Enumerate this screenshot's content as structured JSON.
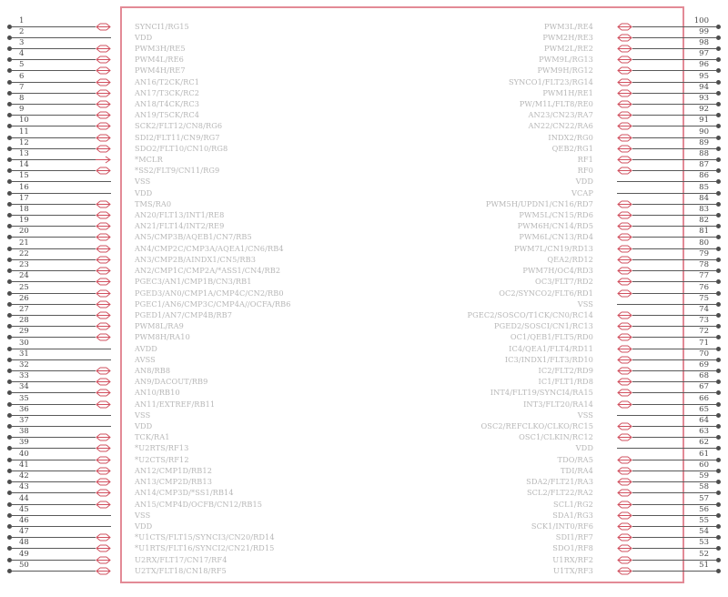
{
  "diagram": {
    "type": "ic-pinout",
    "package_pins": 100,
    "colors": {
      "body_outline": "#e38a96",
      "pin_label_text": "#b7b7b7",
      "pin_number_text": "#4a4a4a",
      "lead_line": "#595959",
      "arrow": "#d0505f",
      "background": "#ffffff"
    },
    "left_pins": [
      {
        "num": "1",
        "label": "SYNCI1/RG15",
        "io": "bidir"
      },
      {
        "num": "2",
        "label": "VDD",
        "io": "power"
      },
      {
        "num": "3",
        "label": "PWM3H/RE5",
        "io": "bidir"
      },
      {
        "num": "4",
        "label": "PWM4L/RE6",
        "io": "bidir"
      },
      {
        "num": "5",
        "label": "PWM4H/RE7",
        "io": "bidir"
      },
      {
        "num": "6",
        "label": "AN16/T2CK/RC1",
        "io": "bidir"
      },
      {
        "num": "7",
        "label": "AN17/T3CK/RC2",
        "io": "bidir"
      },
      {
        "num": "8",
        "label": "AN18/T4CK/RC3",
        "io": "bidir"
      },
      {
        "num": "9",
        "label": "AN19/T5CK/RC4",
        "io": "bidir"
      },
      {
        "num": "10",
        "label": "SCK2/FLT12/CN8/RG6",
        "io": "bidir"
      },
      {
        "num": "11",
        "label": "SDI2/FLT11/CN9/RG7",
        "io": "bidir"
      },
      {
        "num": "12",
        "label": "SDO2/FLT10/CN10/RG8",
        "io": "bidir"
      },
      {
        "num": "13",
        "label": "*MCLR",
        "io": "in"
      },
      {
        "num": "14",
        "label": "*SS2/FLT9/CN11/RG9",
        "io": "bidir"
      },
      {
        "num": "15",
        "label": "VSS",
        "io": "power"
      },
      {
        "num": "16",
        "label": "VDD",
        "io": "power"
      },
      {
        "num": "17",
        "label": "TMS/RA0",
        "io": "bidir"
      },
      {
        "num": "18",
        "label": "AN20/FLT13/INT1/RE8",
        "io": "bidir"
      },
      {
        "num": "19",
        "label": "AN21/FLT14/INT2/RE9",
        "io": "bidir"
      },
      {
        "num": "20",
        "label": "AN5/CMP3B/AQEB1/CN7/RB5",
        "io": "bidir"
      },
      {
        "num": "21",
        "label": "AN4/CMP2C/CMP3A/AQEA1/CN6/RB4",
        "io": "bidir"
      },
      {
        "num": "22",
        "label": "AN3/CMP2B/AINDX1/CN5/RB3",
        "io": "bidir"
      },
      {
        "num": "23",
        "label": "AN2/CMP1C/CMP2A/*ASS1/CN4/RB2",
        "io": "bidir"
      },
      {
        "num": "24",
        "label": "PGEC3/AN1/CMP1B/CN3/RB1",
        "io": "bidir"
      },
      {
        "num": "25",
        "label": "PGED3/AN0/CMP1A/CMP4C/CN2/RB0",
        "io": "bidir"
      },
      {
        "num": "26",
        "label": "PGEC1/AN6/CMP3C/CMP4A//OCFA/RB6",
        "io": "bidir"
      },
      {
        "num": "27",
        "label": "PGED1/AN7/CMP4B/RB7",
        "io": "bidir"
      },
      {
        "num": "28",
        "label": "PWM8L/RA9",
        "io": "bidir"
      },
      {
        "num": "29",
        "label": "PWM8H/RA10",
        "io": "bidir"
      },
      {
        "num": "30",
        "label": "AVDD",
        "io": "power"
      },
      {
        "num": "31",
        "label": "AVSS",
        "io": "power"
      },
      {
        "num": "32",
        "label": "AN8/RB8",
        "io": "bidir"
      },
      {
        "num": "33",
        "label": "AN9/DACOUT/RB9",
        "io": "bidir"
      },
      {
        "num": "34",
        "label": "AN10/RB10",
        "io": "bidir"
      },
      {
        "num": "35",
        "label": "AN11/EXTREF/RB11",
        "io": "bidir"
      },
      {
        "num": "36",
        "label": "VSS",
        "io": "power"
      },
      {
        "num": "37",
        "label": "VDD",
        "io": "power"
      },
      {
        "num": "38",
        "label": "TCK/RA1",
        "io": "bidir"
      },
      {
        "num": "39",
        "label": "*U2RTS/RF13",
        "io": "bidir"
      },
      {
        "num": "40",
        "label": "*U2CTS/RF12",
        "io": "bidir"
      },
      {
        "num": "41",
        "label": "AN12/CMP1D/RB12",
        "io": "bidir"
      },
      {
        "num": "42",
        "label": "AN13/CMP2D/RB13",
        "io": "bidir"
      },
      {
        "num": "43",
        "label": "AN14/CMP3D/*SS1/RB14",
        "io": "bidir"
      },
      {
        "num": "44",
        "label": "AN15/CMP4D/OCFB/CN12/RB15",
        "io": "bidir"
      },
      {
        "num": "45",
        "label": "VSS",
        "io": "power"
      },
      {
        "num": "46",
        "label": "VDD",
        "io": "power"
      },
      {
        "num": "47",
        "label": "*U1CTS/FLT15/SYNCI3/CN20/RD14",
        "io": "bidir"
      },
      {
        "num": "48",
        "label": "*U1RTS/FLT16/SYNCI2/CN21/RD15",
        "io": "bidir"
      },
      {
        "num": "49",
        "label": "U2RX/FLT17/CN17/RF4",
        "io": "bidir"
      },
      {
        "num": "50",
        "label": "U2TX/FLT18/CN18/RF5",
        "io": "bidir"
      }
    ],
    "right_pins": [
      {
        "num": "100",
        "label": "PWM3L/RE4",
        "io": "bidir"
      },
      {
        "num": "99",
        "label": "PWM2H/RE3",
        "io": "bidir"
      },
      {
        "num": "98",
        "label": "PWM2L/RE2",
        "io": "bidir"
      },
      {
        "num": "97",
        "label": "PWM9L/RG13",
        "io": "bidir"
      },
      {
        "num": "96",
        "label": "PWM9H/RG12",
        "io": "bidir"
      },
      {
        "num": "95",
        "label": "SYNCO1/FLT23/RG14",
        "io": "bidir"
      },
      {
        "num": "94",
        "label": "PWM1H/RE1",
        "io": "bidir"
      },
      {
        "num": "93",
        "label": "PW/M1L/FLT8/RE0",
        "io": "bidir"
      },
      {
        "num": "92",
        "label": "AN23/CN23/RA7",
        "io": "bidir"
      },
      {
        "num": "91",
        "label": "AN22/CN22/RA6",
        "io": "bidir"
      },
      {
        "num": "90",
        "label": "INDX2/RG0",
        "io": "bidir"
      },
      {
        "num": "89",
        "label": "QEB2/RG1",
        "io": "bidir"
      },
      {
        "num": "88",
        "label": "RF1",
        "io": "bidir"
      },
      {
        "num": "87",
        "label": "RF0",
        "io": "bidir"
      },
      {
        "num": "86",
        "label": "VDD",
        "io": "power"
      },
      {
        "num": "85",
        "label": "VCAP",
        "io": "power"
      },
      {
        "num": "84",
        "label": "PWM5H/UPDN1/CN16/RD7",
        "io": "bidir"
      },
      {
        "num": "83",
        "label": "PWM5L/CN15/RD6",
        "io": "bidir"
      },
      {
        "num": "82",
        "label": "PWM6H/CN14/RD5",
        "io": "bidir"
      },
      {
        "num": "81",
        "label": "PWM6L/CN13/RD4",
        "io": "bidir"
      },
      {
        "num": "80",
        "label": "PWM7L/CN19/RD13",
        "io": "bidir"
      },
      {
        "num": "79",
        "label": "QEA2/RD12",
        "io": "bidir"
      },
      {
        "num": "78",
        "label": "PWM7H/OC4/RD3",
        "io": "bidir"
      },
      {
        "num": "77",
        "label": "OC3/FLT7/RD2",
        "io": "bidir"
      },
      {
        "num": "76",
        "label": "OC2/SYNCO2/FLT6/RD1",
        "io": "bidir"
      },
      {
        "num": "75",
        "label": "VSS",
        "io": "power"
      },
      {
        "num": "74",
        "label": "PGEC2/SOSCO/T1CK/CN0/RC14",
        "io": "bidir"
      },
      {
        "num": "73",
        "label": "PGED2/SOSCI/CN1/RC13",
        "io": "bidir"
      },
      {
        "num": "72",
        "label": "OC1/QEB1/FLT5/RD0",
        "io": "bidir"
      },
      {
        "num": "71",
        "label": "IC4/QEA1/FLT4/RD11",
        "io": "bidir"
      },
      {
        "num": "70",
        "label": "IC3/INDX1/FLT3/RD10",
        "io": "bidir"
      },
      {
        "num": "69",
        "label": "IC2/FLT2/RD9",
        "io": "bidir"
      },
      {
        "num": "68",
        "label": "IC1/FLT1/RD8",
        "io": "bidir"
      },
      {
        "num": "67",
        "label": "INT4/FLT19/SYNCI4/RA15",
        "io": "bidir"
      },
      {
        "num": "66",
        "label": "INT3/FLT20/RA14",
        "io": "bidir"
      },
      {
        "num": "65",
        "label": "VSS",
        "io": "power"
      },
      {
        "num": "64",
        "label": "OSC2/REFCLKO/CLKO/RC15",
        "io": "bidir"
      },
      {
        "num": "63",
        "label": "OSC1/CLKIN/RC12",
        "io": "bidir"
      },
      {
        "num": "62",
        "label": "VDD",
        "io": "power"
      },
      {
        "num": "61",
        "label": "TDO/RA5",
        "io": "bidir"
      },
      {
        "num": "60",
        "label": "TDI/RA4",
        "io": "bidir"
      },
      {
        "num": "59",
        "label": "SDA2/FLT21/RA3",
        "io": "bidir"
      },
      {
        "num": "58",
        "label": "SCL2/FLT22/RA2",
        "io": "bidir"
      },
      {
        "num": "57",
        "label": "SCL1/RG2",
        "io": "bidir"
      },
      {
        "num": "56",
        "label": "SDA1/RG3",
        "io": "bidir"
      },
      {
        "num": "55",
        "label": "SCK1/INT0/RF6",
        "io": "bidir"
      },
      {
        "num": "54",
        "label": "SDI1/RF7",
        "io": "bidir"
      },
      {
        "num": "53",
        "label": "SDO1/RF8",
        "io": "bidir"
      },
      {
        "num": "52",
        "label": "U1RX/RF2",
        "io": "bidir"
      },
      {
        "num": "51",
        "label": "U1TX/RF3",
        "io": "bidir"
      }
    ]
  }
}
